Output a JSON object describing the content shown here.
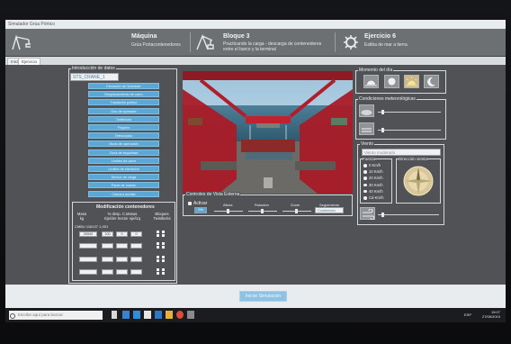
{
  "window": {
    "title": "Simulador Grúa Pórtico"
  },
  "header": {
    "sections": [
      {
        "title": "Máquina",
        "subtitle": "Grúa Portacontenedores",
        "icon": "crane-icon"
      },
      {
        "title": "Bloque 3",
        "subtitle": "Practicando la carga - descarga de contenedores",
        "subtitle2": "entre el barco y la terminal",
        "icon": "crane-block-icon"
      },
      {
        "title": "Ejercicio 6",
        "subtitle": "Estiba de mar a tierra",
        "icon": "gear-icon"
      }
    ]
  },
  "tabs": [
    "Inicio",
    "Ejercicio"
  ],
  "intro": {
    "title": "Introducción de datos",
    "crane_field": "STS_CRANE_1",
    "buttons": [
      "Elevación de Spreader",
      "Desplazamiento de carro",
      "Traslación pórtico",
      "Giro de spreader",
      "Twistlocks",
      "Flippers",
      "Telescópico",
      "Modo de operación",
      "Zona de seguridad",
      "Límites de carro",
      "Límites de elevación",
      "Sensor de carga",
      "Panel de mando",
      "Cámara auxiliar"
    ],
    "mod_title": "Modificación contenedores",
    "col_headers": [
      "Masa\nkg",
      "% desp. C.Masas\nEje/der Sector  eje/izq",
      "Bloques\nTwistlocks"
    ],
    "row_label": "CMBU 116137 1-001",
    "row1_values": [
      "26540",
      "100",
      "0",
      "0"
    ]
  },
  "viewport": {
    "scene": "camera-view-crane-cabin"
  },
  "controls": {
    "title": "Controles de Vista Externa",
    "activate": "Activar",
    "labels": [
      "Altura",
      "Rotación",
      "Zoom",
      "Seguimiento"
    ],
    "value_box": "0%",
    "follow_field": "Contenedor"
  },
  "moment": {
    "title": "Momento del día",
    "options": [
      "sunrise-icon",
      "full-sun-icon",
      "sun-icon",
      "moon-icon"
    ],
    "selected": 2
  },
  "weather": {
    "title": "Condiciones meteorológicas",
    "icons": [
      "cloud-icon",
      "fog-icon",
      "rain-icon"
    ]
  },
  "wind": {
    "title": "Viento",
    "placeholder": "Viento moderado",
    "force_title": "Fuerza",
    "force_options": [
      "0 Km/h",
      "10 Km/h",
      "20 Km/h",
      "30 Km/h",
      "40 Km/h",
      "Cd-Km/h"
    ],
    "direction_title": "Dirección viento"
  },
  "start_label": "Iniciar Simulación",
  "taskbar": {
    "search": "Escribe aquí para buscar",
    "time": "15:07",
    "date": "27/06/2019",
    "lang": "ESP"
  }
}
